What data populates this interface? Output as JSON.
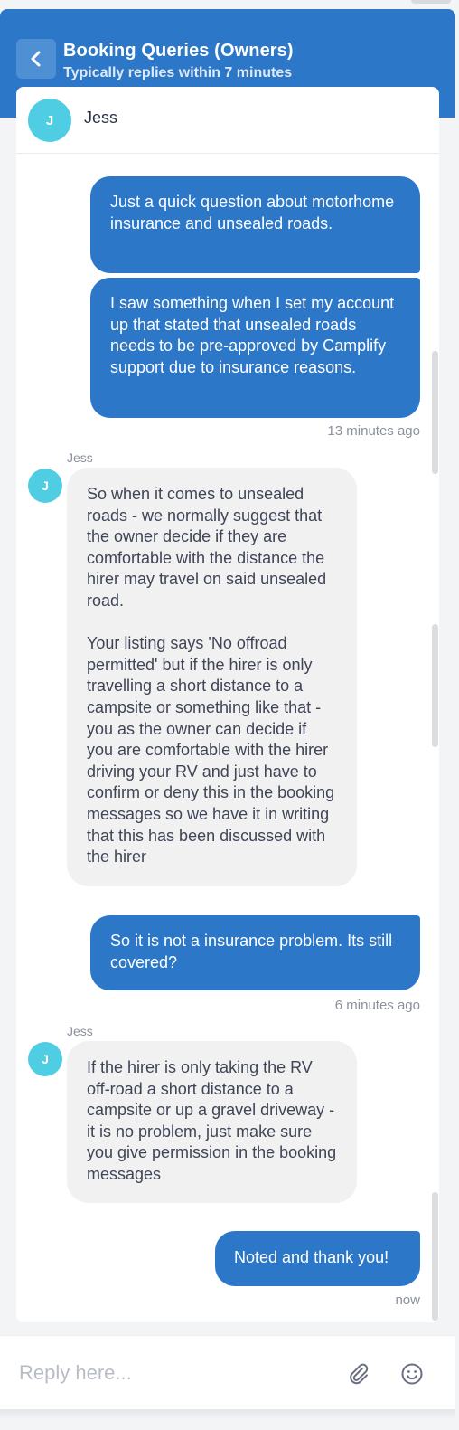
{
  "header": {
    "title": "Booking Queries (Owners)",
    "subtitle": "Typically replies within 7 minutes",
    "back_icon": "chevron-left-icon"
  },
  "agent": {
    "initial": "J",
    "name": "Jess"
  },
  "messages": [
    {
      "direction": "outgoing",
      "text": "Just a quick question about motorhome insurance and unsealed roads."
    },
    {
      "direction": "outgoing",
      "text": "I saw something when I set my account up that stated that unsealed roads needs to be pre-approved by Camplify support due to insurance reasons.",
      "time": "13 minutes ago"
    },
    {
      "direction": "incoming",
      "sender": "Jess",
      "avatar_initial": "J",
      "text": "So when it comes to unsealed roads - we normally suggest that the owner decide if they are comfortable with the distance the hirer may travel on said unsealed road.\n\nYour listing says 'No offroad permitted' but if the hirer is only travelling a short distance to a campsite or something like that - you as the owner can decide if you are comfortable with the hirer driving your RV and just have to confirm or deny this in the booking messages so we have it in writing that this has been discussed with the hirer"
    },
    {
      "direction": "outgoing",
      "text": "So it is not a insurance problem. Its still covered?",
      "time": "6 minutes ago"
    },
    {
      "direction": "incoming",
      "sender": "Jess",
      "avatar_initial": "J",
      "text": "If the hirer is only taking the RV off-road a short distance to a campsite or up a gravel driveway - it is no problem, just make sure you give permission in the booking messages"
    },
    {
      "direction": "outgoing",
      "text": "Noted and thank you!",
      "time": "now"
    }
  ],
  "composer": {
    "placeholder": "Reply here...",
    "attach_icon": "paperclip-icon",
    "emoji_icon": "smiley-icon"
  },
  "colors": {
    "brand": "#2c77c7",
    "avatar": "#4fcde3",
    "incoming_bubble": "#f1f1f2"
  }
}
